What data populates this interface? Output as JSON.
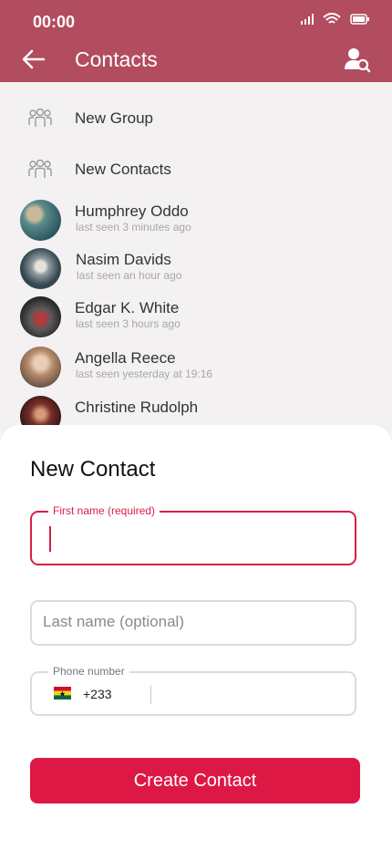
{
  "status_bar": {
    "time": "00:00"
  },
  "header": {
    "title": "Contacts"
  },
  "actions": [
    {
      "label": "New Group"
    },
    {
      "label": "New Contacts"
    }
  ],
  "contacts": [
    {
      "name": "Humphrey Oddo",
      "last_seen": "last seen 3 minutes ago"
    },
    {
      "name": "Nasim Davids",
      "last_seen": "last seen an hour ago"
    },
    {
      "name": "Edgar K. White",
      "last_seen": "last seen 3 hours ago"
    },
    {
      "name": "Angella Reece",
      "last_seen": "last seen yesterday at 19:16"
    },
    {
      "name": "Christine Rudolph",
      "last_seen": ""
    }
  ],
  "new_contact": {
    "title": "New Contact",
    "first_name": {
      "label": "First name (required)",
      "value": ""
    },
    "last_name": {
      "placeholder": "Last name (optional)",
      "value": ""
    },
    "phone": {
      "label": "Phone number",
      "dial_code": "+233",
      "value": ""
    },
    "submit_label": "Create Contact"
  },
  "colors": {
    "header": "#b24c5f",
    "accent": "#de1845",
    "background": "#f3f1f2"
  }
}
